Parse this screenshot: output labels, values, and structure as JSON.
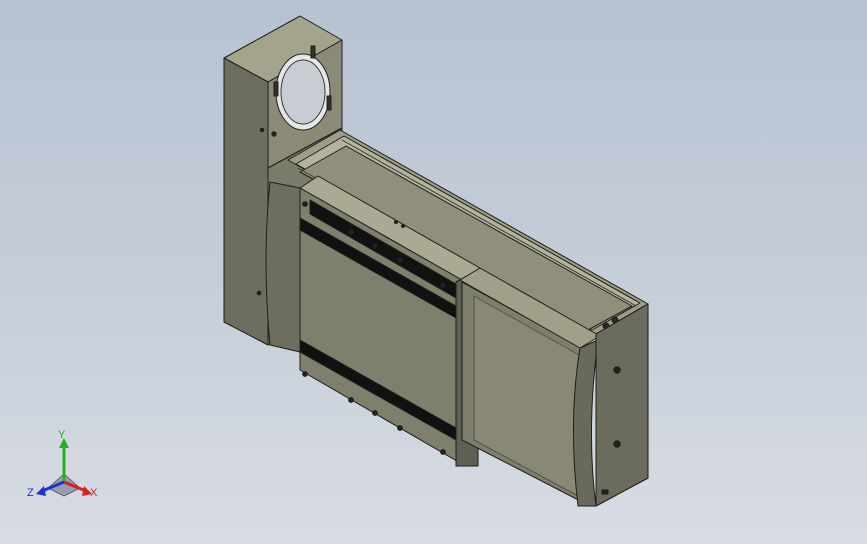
{
  "viewport": {
    "background_top": "#b7c2d2",
    "background_bottom": "#d8dce3"
  },
  "model": {
    "body_color": "#7b7b6b",
    "shadow_color": "#55554a",
    "highlight_color": "#a8a892",
    "edge_color": "#1e1e1a",
    "belt_color": "#111111"
  },
  "triad": {
    "x_label": "X",
    "y_label": "Y",
    "z_label": "Z",
    "x_color": "#d62020",
    "y_color": "#22b022",
    "z_color": "#2030d0"
  }
}
